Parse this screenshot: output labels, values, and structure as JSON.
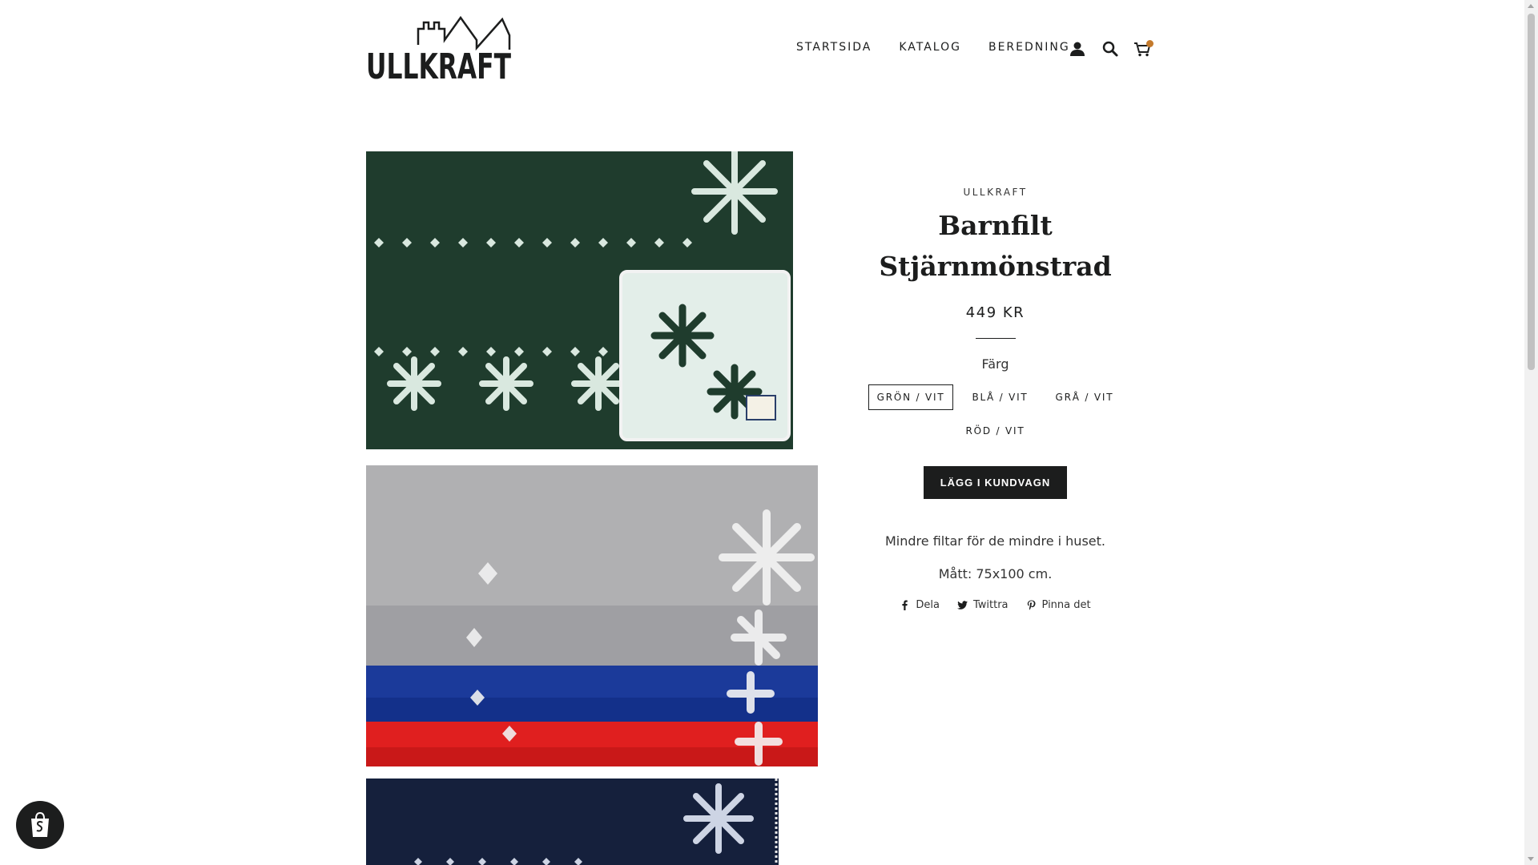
{
  "logo": {
    "text": "ULLKRAFT"
  },
  "nav": {
    "links": [
      "STARTSIDA",
      "KATALOG",
      "BEREDNING"
    ],
    "icons": [
      "account-icon",
      "search-icon",
      "cart-icon"
    ]
  },
  "product": {
    "vendor": "ULLKRAFT",
    "title_line1": "Barnfilt",
    "title_line2": "Stjärnmönstrad",
    "price": "449 KR",
    "option_label": "Färg",
    "swatches": [
      "GRÖN / VIT",
      "BLÅ / VIT",
      "GRÅ / VIT",
      "RÖD / VIT"
    ],
    "selected_swatch": "GRÖN / VIT",
    "add_to_cart": "LÄGG I KUNDVAGN",
    "description": [
      "Mindre filtar för de mindre i huset.",
      "Mått: 75x100 cm."
    ],
    "share": [
      "Dela",
      "Twittra",
      "Pinna det"
    ]
  },
  "colors": {
    "text": "#1c1d1d",
    "button_bg": "#1c1d1d",
    "cart_badge": "#c47a2c",
    "blanket_green": "#1f3c2d",
    "blanket_navy": "#15203c"
  }
}
